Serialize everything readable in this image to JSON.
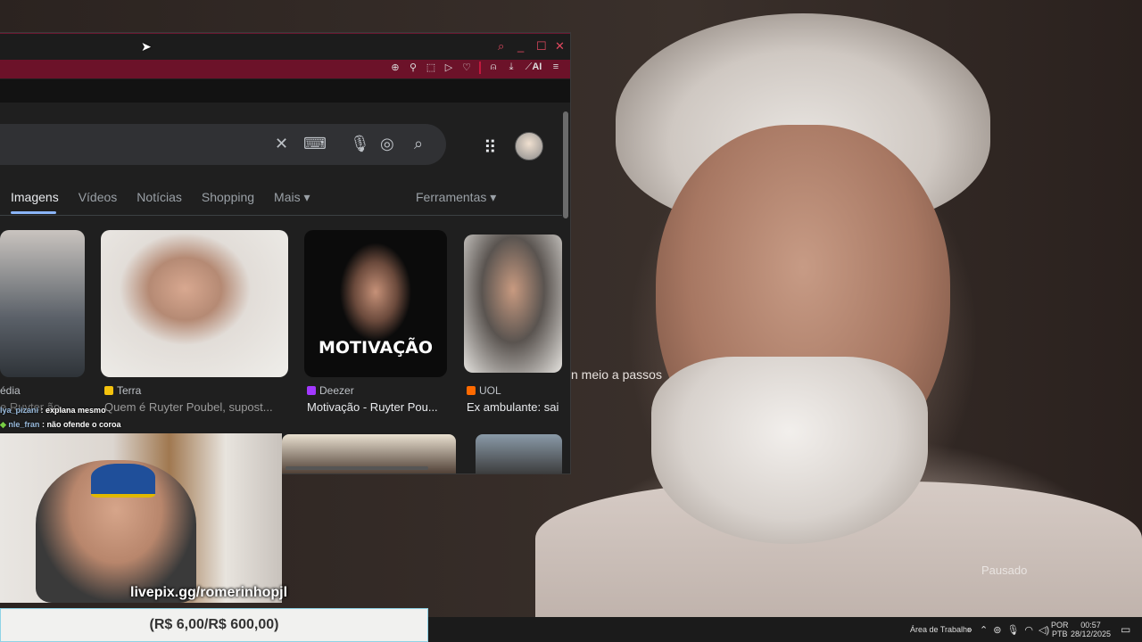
{
  "video": {
    "subtitle": "n meio a passos",
    "status": "Pausado"
  },
  "browser": {
    "window_controls": [
      "search-icon",
      "minimize-icon",
      "maximize-icon",
      "close-icon"
    ],
    "address_icons": [
      "zoom-icon",
      "pin-icon",
      "screenshot-icon",
      "play-icon",
      "heart-icon",
      "profile-icon",
      "download-icon",
      "ai-tools-icon",
      "menu-icon"
    ],
    "ai_label": "AI"
  },
  "google": {
    "tabs": [
      "Imagens",
      "Vídeos",
      "Notícias",
      "Shopping",
      "Mais ▾"
    ],
    "active_tab": "Imagens",
    "tools": "Ferramentas ▾",
    "results": [
      {
        "source": "édia",
        "title": "e Ruyter ão..."
      },
      {
        "source": "Terra",
        "title": "Quem é Ruyter Poubel, supost...",
        "color": "#f4c20d"
      },
      {
        "source": "Deezer",
        "title": "Motivação - Ruyter Pou...",
        "color": "#a238ff",
        "overlay": "MOTIVAÇÃO"
      },
      {
        "source": "UOL",
        "title": "Ex ambulante: sai",
        "color": "#ff6a00"
      }
    ]
  },
  "chat": [
    {
      "user": "lya_pizani",
      "message": "explana mesmo"
    },
    {
      "user": "nle_fran",
      "message": "não ofende o coroa"
    }
  ],
  "stream": {
    "livepix": "livepix.gg/romerinhopjl",
    "donation": "(R$ 6,00/R$ 600,00)"
  },
  "taskbar": {
    "desktop": "Área de Trabalho",
    "lang_top": "POR",
    "lang_bottom": "PTB",
    "time": "00:57",
    "date": "28/12/2025"
  }
}
